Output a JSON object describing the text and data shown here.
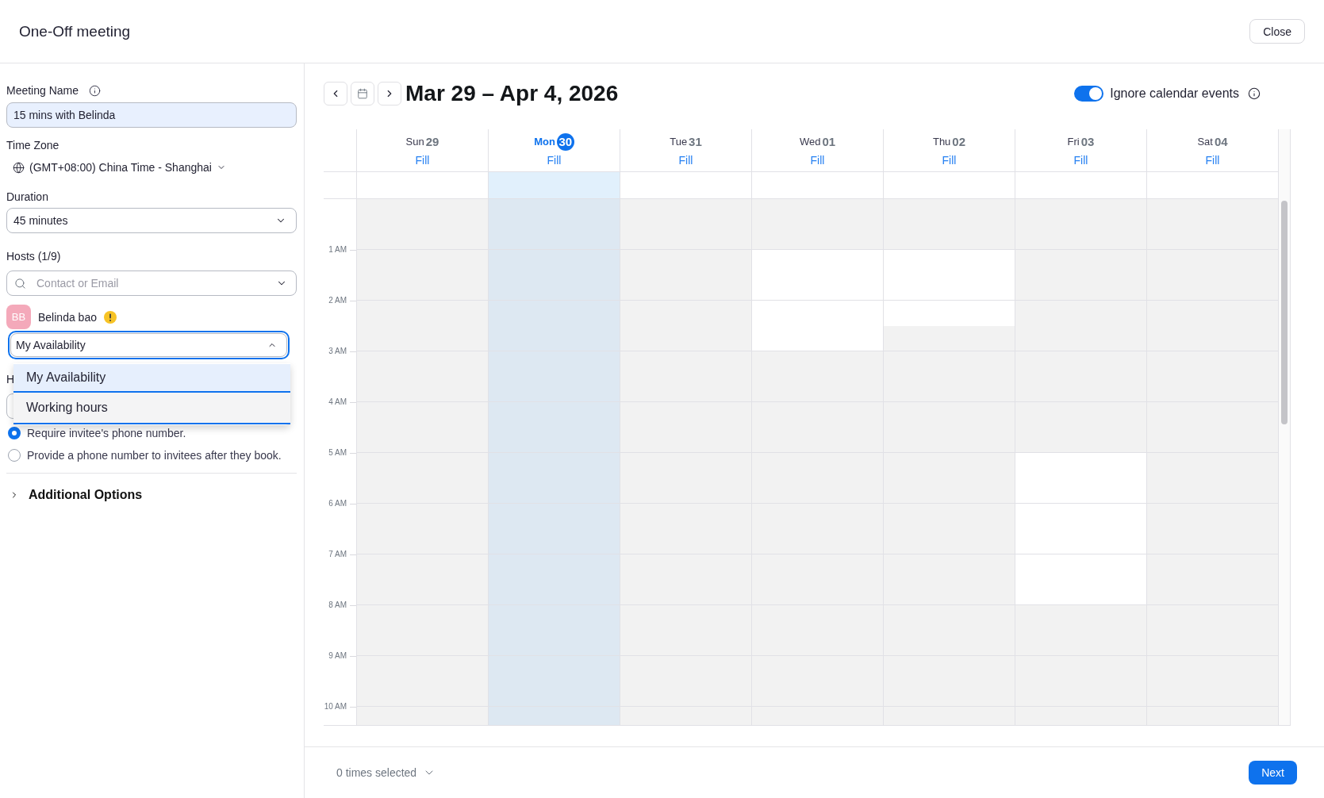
{
  "window": {
    "title": "One-Off meeting",
    "close_button": "Close"
  },
  "form": {
    "meeting_name": {
      "label": "Meeting Name",
      "value": "15 mins with Belinda"
    },
    "time_zone": {
      "label": "Time Zone",
      "value": "(GMT+08:00) China Time - Shanghai"
    },
    "duration": {
      "label": "Duration",
      "value": "45 minutes"
    },
    "hosts": {
      "label": "Hosts (1/9)",
      "search_placeholder": "Contact or Email",
      "members": [
        {
          "initials": "BB",
          "name": "Belinda bao",
          "warning": true,
          "availability": {
            "value": "My Availability",
            "focused": true,
            "expanded": true,
            "options": [
              {
                "label": "My Availability",
                "selected": true
              },
              {
                "label": "Working hours",
                "selected": false
              }
            ]
          }
        }
      ]
    },
    "phone_section": {
      "label": "H",
      "options": [
        {
          "label": "Require invitee's phone number.",
          "selected": true
        },
        {
          "label": "Provide a phone number to invitees after they book.",
          "selected": false
        }
      ]
    },
    "additional_options": {
      "label": "Additional Options",
      "expanded": false
    }
  },
  "calendar": {
    "range_title": "Mar 29 – Apr 4, 2026",
    "ignore_calendar_events": {
      "label": "Ignore calendar events",
      "on": true
    },
    "hour_labels": [
      "1 AM",
      "2 AM",
      "3 AM",
      "4 AM",
      "5 AM",
      "6 AM",
      "7 AM",
      "8 AM",
      "9 AM",
      "10 AM"
    ],
    "days": [
      {
        "weekday": "Sun",
        "date": "29",
        "fill": "Fill",
        "today": false,
        "available": [
          false,
          false,
          false,
          false,
          false,
          false,
          false,
          false,
          false,
          false,
          false,
          false,
          false,
          false,
          false,
          false,
          false,
          false,
          false,
          false,
          false
        ]
      },
      {
        "weekday": "Mon",
        "date": "30",
        "fill": "Fill",
        "today": true,
        "available": [
          false,
          false,
          false,
          false,
          false,
          false,
          false,
          false,
          false,
          false,
          false,
          false,
          false,
          false,
          false,
          false,
          false,
          false,
          false,
          false,
          false
        ]
      },
      {
        "weekday": "Tue",
        "date": "31",
        "fill": "Fill",
        "today": false,
        "available": [
          false,
          false,
          false,
          false,
          false,
          false,
          false,
          false,
          false,
          false,
          false,
          false,
          false,
          false,
          false,
          false,
          false,
          false,
          false,
          false,
          false
        ]
      },
      {
        "weekday": "Wed",
        "date": "01",
        "fill": "Fill",
        "today": false,
        "available": [
          false,
          false,
          true,
          true,
          true,
          true,
          false,
          false,
          false,
          false,
          false,
          false,
          false,
          false,
          false,
          false,
          false,
          false,
          false,
          false,
          false
        ]
      },
      {
        "weekday": "Thu",
        "date": "02",
        "fill": "Fill",
        "today": false,
        "available": [
          false,
          false,
          true,
          true,
          true,
          false,
          false,
          false,
          false,
          false,
          false,
          false,
          false,
          false,
          false,
          false,
          false,
          false,
          false,
          false,
          false
        ]
      },
      {
        "weekday": "Fri",
        "date": "03",
        "fill": "Fill",
        "today": false,
        "available": [
          false,
          false,
          false,
          false,
          false,
          false,
          false,
          false,
          false,
          false,
          true,
          true,
          true,
          true,
          true,
          true,
          false,
          false,
          false,
          false,
          false
        ]
      },
      {
        "weekday": "Sat",
        "date": "04",
        "fill": "Fill",
        "today": false,
        "available": [
          false,
          false,
          false,
          false,
          false,
          false,
          false,
          false,
          false,
          false,
          false,
          false,
          false,
          false,
          false,
          false,
          false,
          false,
          false,
          false,
          false
        ]
      }
    ]
  },
  "footer": {
    "selection_summary": "0 times selected",
    "next_button": "Next"
  }
}
